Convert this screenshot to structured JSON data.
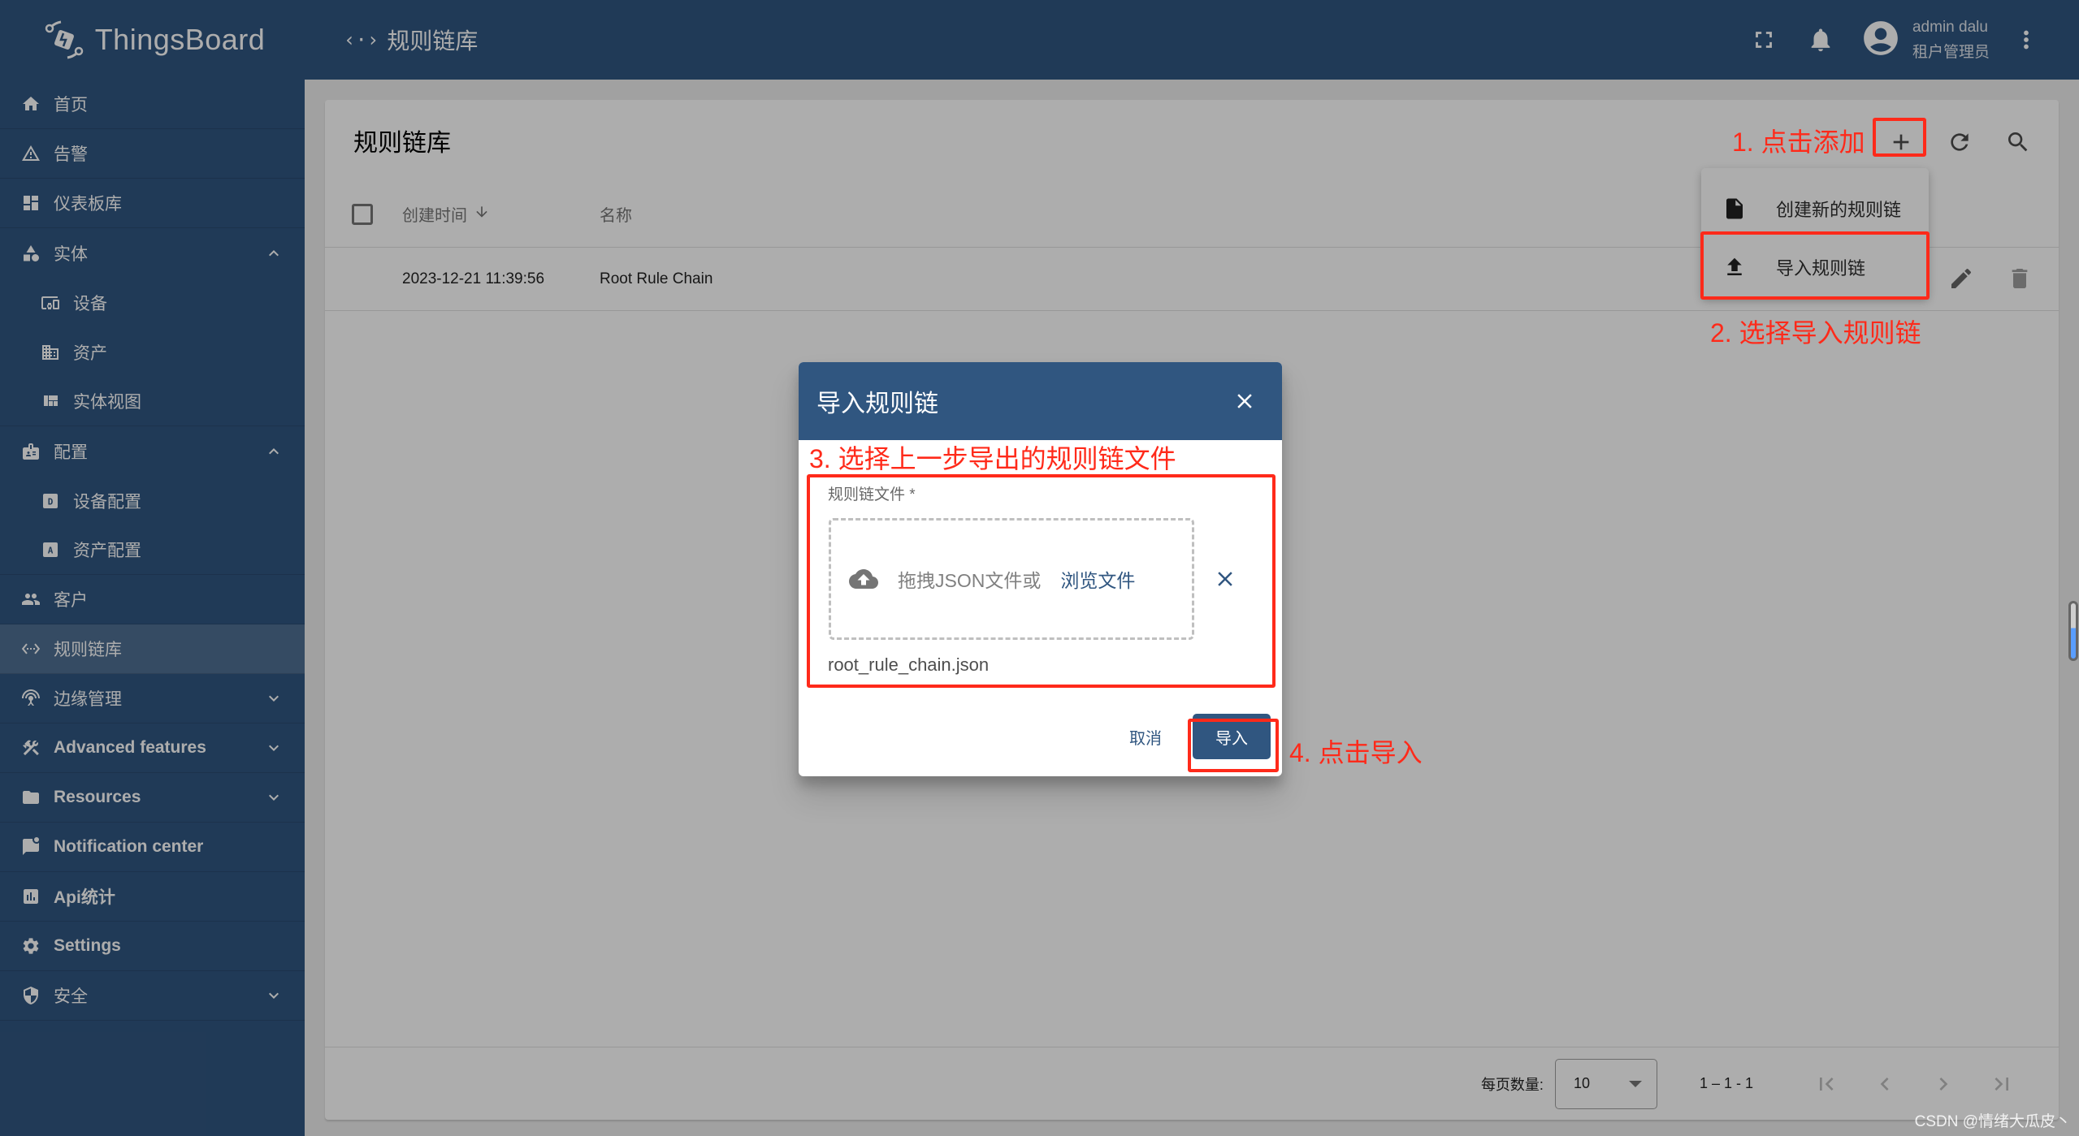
{
  "app": {
    "brand": "ThingsBoard",
    "page_title": "规则链库"
  },
  "topbar": {
    "icons": [
      "fullscreen-icon",
      "notifications-icon",
      "account-circle-icon",
      "more-vert-icon"
    ],
    "user_name": "admin dalu",
    "user_role": "租户管理员"
  },
  "sidebar": {
    "items": [
      {
        "label": "首页",
        "icon": "home-icon"
      },
      {
        "label": "告警",
        "icon": "warning-icon"
      },
      {
        "label": "仪表板库",
        "icon": "dashboard-icon"
      },
      {
        "label": "实体",
        "icon": "category-icon",
        "expanded": true
      },
      {
        "label": "设备",
        "icon": "devices-icon"
      },
      {
        "label": "资产",
        "icon": "domain-icon"
      },
      {
        "label": "实体视图",
        "icon": "view-quilt-icon"
      },
      {
        "label": "配置",
        "icon": "badge-icon",
        "expanded": true
      },
      {
        "label": "设备配置",
        "icon": "device-profile-icon"
      },
      {
        "label": "资产配置",
        "icon": "asset-profile-icon"
      },
      {
        "label": "客户",
        "icon": "people-icon"
      },
      {
        "label": "规则链库",
        "icon": "settings-ethernet-icon",
        "active": true
      },
      {
        "label": "边缘管理",
        "icon": "router-icon",
        "expanded": false
      },
      {
        "label": "Advanced features",
        "icon": "construction-icon",
        "expanded": false
      },
      {
        "label": "Resources",
        "icon": "folder-icon",
        "expanded": false
      },
      {
        "label": "Notification center",
        "icon": "mark-chat-unread-icon"
      },
      {
        "label": "Api统计",
        "icon": "insert-chart-icon"
      },
      {
        "label": "Settings",
        "icon": "settings-icon"
      },
      {
        "label": "安全",
        "icon": "security-icon",
        "expanded": false
      }
    ]
  },
  "card": {
    "title": "规则链库",
    "actions": [
      "add-icon",
      "refresh-icon",
      "search-icon"
    ]
  },
  "table": {
    "columns": [
      "创建时间",
      "名称"
    ],
    "sort_column": "创建时间",
    "sort_direction": "desc",
    "rows": [
      {
        "created": "2023-12-21 11:39:56",
        "name": "Root Rule Chain"
      }
    ]
  },
  "add_menu": {
    "items": [
      {
        "label": "创建新的规则链",
        "icon": "insert-drive-file-icon"
      },
      {
        "label": "导入规则链",
        "icon": "file-upload-icon"
      }
    ]
  },
  "paginator": {
    "page_size_label": "每页数量:",
    "page_size": "10",
    "range": "1 – 1 - 1"
  },
  "dialog": {
    "title": "导入规则链",
    "field_label": "规则链文件 *",
    "drop_text": "拖拽JSON文件或",
    "browse_label": "浏览文件",
    "file_name": "root_rule_chain.json",
    "cancel_label": "取消",
    "import_label": "导入"
  },
  "annotations": {
    "step1": "1. 点击添加",
    "step2": "2. 选择导入规则链",
    "step3": "3. 选择上一步导出的规则链文件",
    "step4": "4. 点击导入",
    "color": "#ff2a1a"
  },
  "watermark": "CSDN @情绪大瓜皮丶",
  "colors": {
    "primary": "#305680",
    "annotation": "#ff2a1a"
  }
}
